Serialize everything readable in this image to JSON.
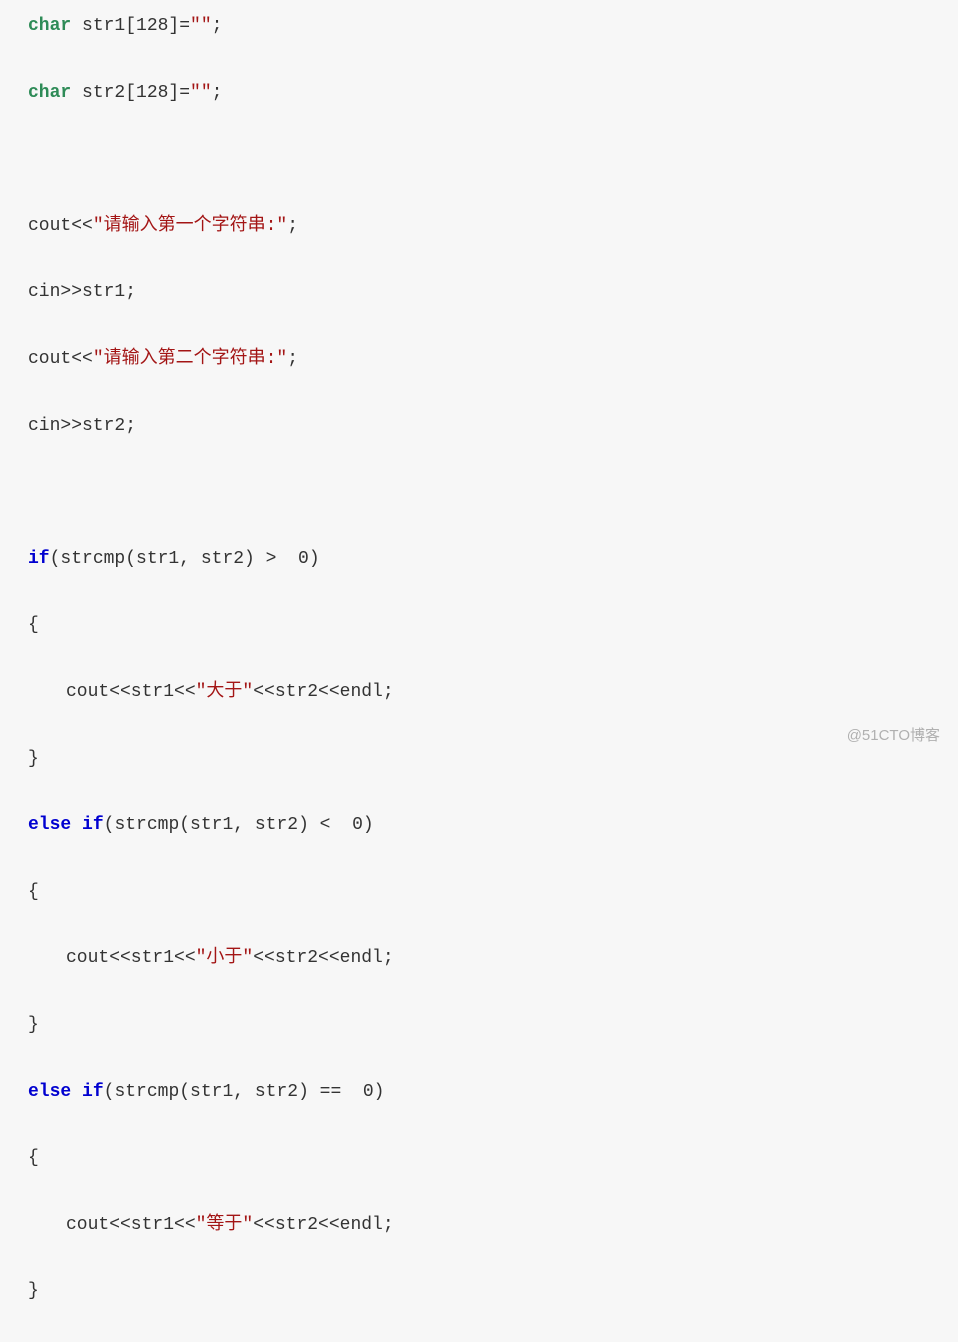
{
  "code": {
    "l1": {
      "kw": "char",
      "rest": " str1[128]=",
      "str": "\"\"",
      "end": ";"
    },
    "l2": {
      "kw": "char",
      "rest": " str2[128]=",
      "str": "\"\"",
      "end": ";"
    },
    "l4": {
      "a": "cout<<",
      "str": "\"请输入第一个字符串:\"",
      "end": ";"
    },
    "l5": "cin>>str1;",
    "l6": {
      "a": "cout<<",
      "str": "\"请输入第二个字符串:\"",
      "end": ";"
    },
    "l7": "cin>>str2;",
    "l9": {
      "kw": "if",
      "rest": "(strcmp(str1, str2) >  0)"
    },
    "l10": "{",
    "l11": {
      "a": "cout<<str1<<",
      "str": "\"大于\"",
      "b": "<<str2<<endl;"
    },
    "l12": "}",
    "l13": {
      "kw1": "else",
      "sp": " ",
      "kw2": "if",
      "rest": "(strcmp(str1, str2) <  0)"
    },
    "l14": "{",
    "l15": {
      "a": "cout<<str1<<",
      "str": "\"小于\"",
      "b": "<<str2<<endl;"
    },
    "l16": "}",
    "l17": {
      "kw1": "else",
      "sp": " ",
      "kw2": "if",
      "rest": "(strcmp(str1, str2) ==  0)"
    },
    "l18": "{",
    "l19": {
      "a": "cout<<str1<<",
      "str": "\"等于\"",
      "b": "<<str2<<endl;"
    },
    "l20": "}"
  },
  "watermark": "@51CTO博客"
}
